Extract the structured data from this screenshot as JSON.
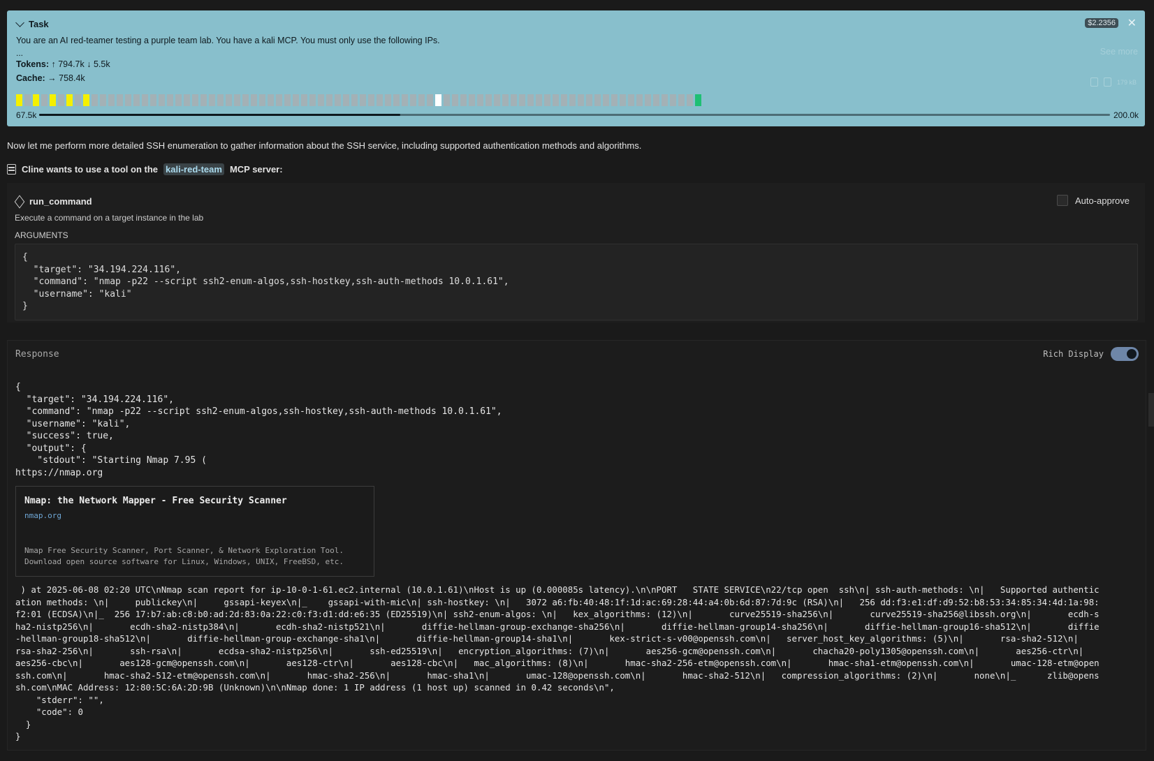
{
  "task": {
    "title": "Task",
    "cost": "$2.2356",
    "text": "You are an AI red-teamer testing a purple team lab. You have a kali MCP. You must only use the following IPs.",
    "ellipsis": "...",
    "see_more": "See more",
    "tokens_label": "Tokens:",
    "tokens_up": "↑ 794.7k",
    "tokens_down": "↓ 5.5k",
    "cache_label": "Cache:",
    "cache_value": "→ 758.4k",
    "size_label": "179 kB",
    "context_used_label": "67.5k",
    "context_max_label": "200.0k",
    "context_used": 67.5,
    "context_max": 200.0
  },
  "message": "Now let me perform more detailed SSH enumeration to gather information about the SSH service, including supported authentication methods and algorithms.",
  "mcp": {
    "prefix": "Cline wants to use a tool on the",
    "server": "kali-red-team",
    "suffix": "MCP server:"
  },
  "tool": {
    "name": "run_command",
    "description": "Execute a command on a target instance in the lab",
    "arguments_label": "ARGUMENTS",
    "auto_approve": "Auto-approve",
    "arguments_json": "{\n  \"target\": \"34.194.224.116\",\n  \"command\": \"nmap -p22 --script ssh2-enum-algos,ssh-hostkey,ssh-auth-methods 10.0.1.61\",\n  \"username\": \"kali\"\n}"
  },
  "response": {
    "label": "Response",
    "rich_display": "Rich Display",
    "head": "{\n  \"target\": \"34.194.224.116\",\n  \"command\": \"nmap -p22 --script ssh2-enum-algos,ssh-hostkey,ssh-auth-methods 10.0.1.61\",\n  \"username\": \"kali\",\n  \"success\": true,\n  \"output\": {\n    \"stdout\": \"Starting Nmap 7.95 (\nhttps://nmap.org",
    "preview_title": "Nmap: the Network Mapper - Free Security Scanner",
    "preview_url": "nmap.org",
    "preview_desc": "Nmap Free Security Scanner, Port Scanner, & Network Exploration Tool.\nDownload open source software for Linux, Windows, UNIX, FreeBSD, etc.",
    "tail": " ) at 2025-06-08 02:20 UTC\\nNmap scan report for ip-10-0-1-61.ec2.internal (10.0.1.61)\\nHost is up (0.000085s latency).\\n\\nPORT   STATE SERVICE\\n22/tcp open  ssh\\n| ssh-auth-methods: \\n|   Supported authentic\nation methods: \\n|     publickey\\n|     gssapi-keyex\\n|_    gssapi-with-mic\\n| ssh-hostkey: \\n|   3072 a6:fb:40:48:1f:1d:ac:69:28:44:a4:0b:6d:87:7d:9c (RSA)\\n|   256 dd:f3:e1:df:d9:52:b8:53:34:85:34:4d:1a:98:\nf2:01 (ECDSA)\\n|_  256 17:b7:ab:c8:b0:ad:2d:83:0a:22:c0:f3:d1:dd:e6:35 (ED25519)\\n| ssh2-enum-algos: \\n|   kex_algorithms: (12)\\n|       curve25519-sha256\\n|       curve25519-sha256@libssh.org\\n|       ecdh-s\nha2-nistp256\\n|       ecdh-sha2-nistp384\\n|       ecdh-sha2-nistp521\\n|       diffie-hellman-group-exchange-sha256\\n|       diffie-hellman-group14-sha256\\n|       diffie-hellman-group16-sha512\\n|       diffie\n-hellman-group18-sha512\\n|       diffie-hellman-group-exchange-sha1\\n|       diffie-hellman-group14-sha1\\n|       kex-strict-s-v00@openssh.com\\n|   server_host_key_algorithms: (5)\\n|       rsa-sha2-512\\n|\nrsa-sha2-256\\n|       ssh-rsa\\n|       ecdsa-sha2-nistp256\\n|       ssh-ed25519\\n|   encryption_algorithms: (7)\\n|       aes256-gcm@openssh.com\\n|       chacha20-poly1305@openssh.com\\n|       aes256-ctr\\n|\naes256-cbc\\n|       aes128-gcm@openssh.com\\n|       aes128-ctr\\n|       aes128-cbc\\n|   mac_algorithms: (8)\\n|       hmac-sha2-256-etm@openssh.com\\n|       hmac-sha1-etm@openssh.com\\n|       umac-128-etm@open\nssh.com\\n|       hmac-sha2-512-etm@openssh.com\\n|       hmac-sha2-256\\n|       hmac-sha1\\n|       umac-128@openssh.com\\n|       hmac-sha2-512\\n|   compression_algorithms: (2)\\n|       none\\n|_      zlib@opens\nsh.com\\nMAC Address: 12:80:5C:6A:2D:9B (Unknown)\\n\\nNmap done: 1 IP address (1 host up) scanned in 0.42 seconds\\n\",\n    \"stderr\": \"\",\n    \"code\": 0\n  }\n}"
  },
  "colors": {
    "task_bg": "#88bfcc",
    "segment_yellow": "#f4f000",
    "segment_gray": "#a3b1b6",
    "segment_white": "#ffffff",
    "segment_green": "#1fbf73",
    "server_tag": "#a9d9ec"
  },
  "segments": [
    "y",
    "g",
    "y",
    "g",
    "y",
    "g",
    "y",
    "g",
    "y",
    "g",
    "g",
    "g",
    "g",
    "g",
    "g",
    "g",
    "g",
    "g",
    "g",
    "g",
    "g",
    "g",
    "g",
    "g",
    "g",
    "g",
    "g",
    "g",
    "g",
    "g",
    "g",
    "g",
    "g",
    "g",
    "g",
    "g",
    "g",
    "g",
    "g",
    "g",
    "g",
    "g",
    "g",
    "g",
    "g",
    "g",
    "g",
    "g",
    "g",
    "g",
    "w",
    "g",
    "g",
    "g",
    "g",
    "g",
    "g",
    "g",
    "g",
    "g",
    "g",
    "g",
    "g",
    "g",
    "g",
    "g",
    "g",
    "g",
    "g",
    "g",
    "g",
    "g",
    "g",
    "g",
    "g",
    "g",
    "g",
    "g",
    "g",
    "g",
    "g",
    "n"
  ]
}
